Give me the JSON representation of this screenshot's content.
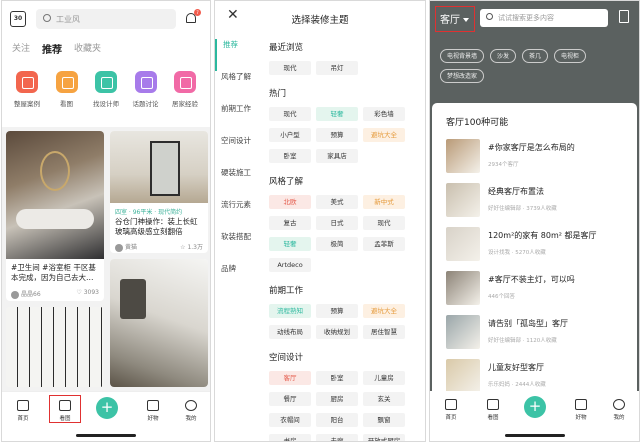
{
  "panel1": {
    "calendar_day": "30",
    "search_placeholder": "工业风",
    "notification_count": "7",
    "tabs": [
      "关注",
      "推荐",
      "收藏夹"
    ],
    "categories": [
      {
        "label": "整屋案例",
        "color": "#f2664e"
      },
      {
        "label": "看图",
        "color": "#f6a341"
      },
      {
        "label": "找设计师",
        "color": "#3cc3a6"
      },
      {
        "label": "话题讨论",
        "color": "#a77bea"
      },
      {
        "label": "居家经验",
        "color": "#f16aa6"
      }
    ],
    "cards": [
      {
        "text": "#卫生间 #浴室柜 干区基本完成，因为自己去大…",
        "user": "晶晶66",
        "stat": "3093"
      },
      {
        "tag": "四室 · 96平米 · 现代简约",
        "text": "谷仓门神操作：装上长虹玻璃高级感立刻翻倍",
        "user": "黄猫",
        "stat": "1.3万"
      }
    ],
    "nav": [
      "首页",
      "看图",
      "",
      "好物",
      "我的"
    ]
  },
  "panel2": {
    "title": "选择装修主题",
    "sidebar": [
      "推荐",
      "风格了解",
      "前期工作",
      "空间设计",
      "硬装施工",
      "流行元素",
      "软装搭配",
      "品牌"
    ],
    "sections": [
      {
        "title": "最近浏览",
        "chips": [
          {
            "t": "现代",
            "c": "plain"
          },
          {
            "t": "吊灯",
            "c": "plain"
          }
        ]
      },
      {
        "title": "热门",
        "chips": [
          {
            "t": "现代",
            "c": "plain"
          },
          {
            "t": "轻奢",
            "c": "green"
          },
          {
            "t": "彩色墙",
            "c": "plain"
          },
          {
            "t": "小户型",
            "c": "plain"
          },
          {
            "t": "预算",
            "c": "plain"
          },
          {
            "t": "避坑大全",
            "c": "orange"
          },
          {
            "t": "卧室",
            "c": "plain"
          },
          {
            "t": "家具店",
            "c": "plain"
          }
        ]
      },
      {
        "title": "风格了解",
        "chips": [
          {
            "t": "北欧",
            "c": "red"
          },
          {
            "t": "美式",
            "c": "plain"
          },
          {
            "t": "新中式",
            "c": "orange"
          },
          {
            "t": "复古",
            "c": "plain"
          },
          {
            "t": "日式",
            "c": "plain"
          },
          {
            "t": "现代",
            "c": "plain"
          },
          {
            "t": "轻奢",
            "c": "green"
          },
          {
            "t": "极简",
            "c": "plain"
          },
          {
            "t": "孟菲斯",
            "c": "plain"
          },
          {
            "t": "Artdeco",
            "c": "plain"
          }
        ]
      },
      {
        "title": "前期工作",
        "chips": [
          {
            "t": "流程熟知",
            "c": "green"
          },
          {
            "t": "预算",
            "c": "plain"
          },
          {
            "t": "避坑大全",
            "c": "orange"
          },
          {
            "t": "动线布局",
            "c": "plain"
          },
          {
            "t": "收纳规划",
            "c": "plain"
          },
          {
            "t": "居住智慧",
            "c": "plain"
          }
        ]
      },
      {
        "title": "空间设计",
        "chips": [
          {
            "t": "客厅",
            "c": "red"
          },
          {
            "t": "卧室",
            "c": "plain"
          },
          {
            "t": "儿童房",
            "c": "plain"
          },
          {
            "t": "餐厅",
            "c": "plain"
          },
          {
            "t": "厨房",
            "c": "plain"
          },
          {
            "t": "玄关",
            "c": "plain"
          },
          {
            "t": "衣帽间",
            "c": "plain"
          },
          {
            "t": "阳台",
            "c": "plain"
          },
          {
            "t": "飘窗",
            "c": "plain"
          },
          {
            "t": "书房",
            "c": "plain"
          },
          {
            "t": "走廊",
            "c": "plain"
          },
          {
            "t": "开放式厨房",
            "c": "plain"
          }
        ]
      }
    ]
  },
  "panel3": {
    "room": "客厅",
    "search_placeholder": "试试搜索更多内容",
    "pills": [
      "电视背景墙",
      "沙发",
      "茶几",
      "电视柜",
      "梦想改造家"
    ],
    "list_title": "客厅100种可能",
    "items": [
      {
        "title": "#你家客厅是怎么布局的",
        "meta": "2934个客厅",
        "color": "#b99a77"
      },
      {
        "title": "经典客厅布置法",
        "meta": "好好住编辑部 · 3739人收藏",
        "color": "#c9bfae"
      },
      {
        "title": "120m²的家有 80m² 都是客厅",
        "meta": "设计找我 · 5270人收藏",
        "color": "#d8d2c8"
      },
      {
        "title": "#客厅不装主灯，可以吗",
        "meta": "446个回答",
        "color": "#8c8377"
      },
      {
        "title": "请告别「孤岛型」客厅",
        "meta": "好好住编辑部 · 1120人收藏",
        "color": "#9aa6a9"
      },
      {
        "title": "儿童友好型客厅",
        "meta": "乐乐妈妈 · 2444人收藏",
        "color": "#d9c9a8"
      }
    ],
    "nav": [
      "首页",
      "看图",
      "",
      "好物",
      "我的"
    ]
  }
}
